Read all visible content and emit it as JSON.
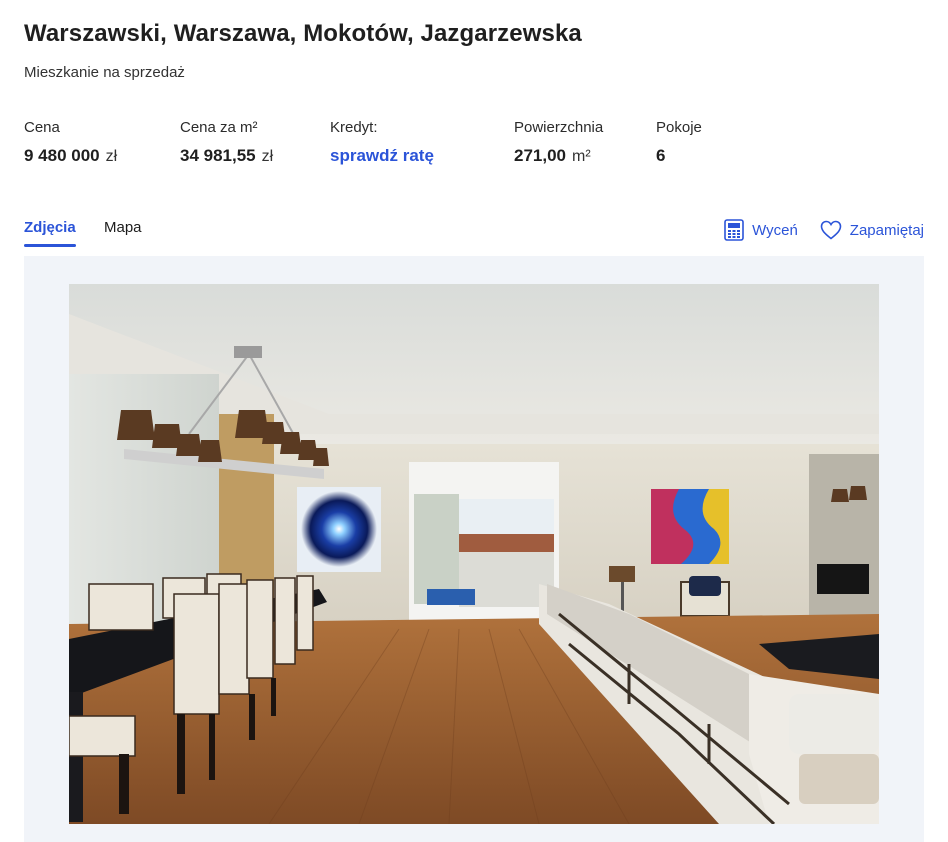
{
  "listing": {
    "title": "Warszawski, Warszawa, Mokotów, Jazgarzewska",
    "subtitle": "Mieszkanie na sprzedaż"
  },
  "facts": {
    "price": {
      "label": "Cena",
      "value": "9 480 000",
      "unit": "zł"
    },
    "price_per_m2": {
      "label": "Cena za m²",
      "value": "34 981,55",
      "unit": "zł"
    },
    "credit": {
      "label": "Kredyt:",
      "link": "sprawdź ratę"
    },
    "area": {
      "label": "Powierzchnia",
      "value": "271,00",
      "unit": "m²"
    },
    "rooms": {
      "label": "Pokoje",
      "value": "6"
    }
  },
  "tabs": [
    {
      "label": "Zdjęcia",
      "active": true
    },
    {
      "label": "Mapa",
      "active": false
    }
  ],
  "actions": {
    "valuate": {
      "label": "Wyceń",
      "icon": "calculator-icon"
    },
    "save": {
      "label": "Zapamiętaj",
      "icon": "heart-icon"
    }
  },
  "colors": {
    "accent": "#2b54d8",
    "gallery_bg": "#f1f4f9"
  }
}
